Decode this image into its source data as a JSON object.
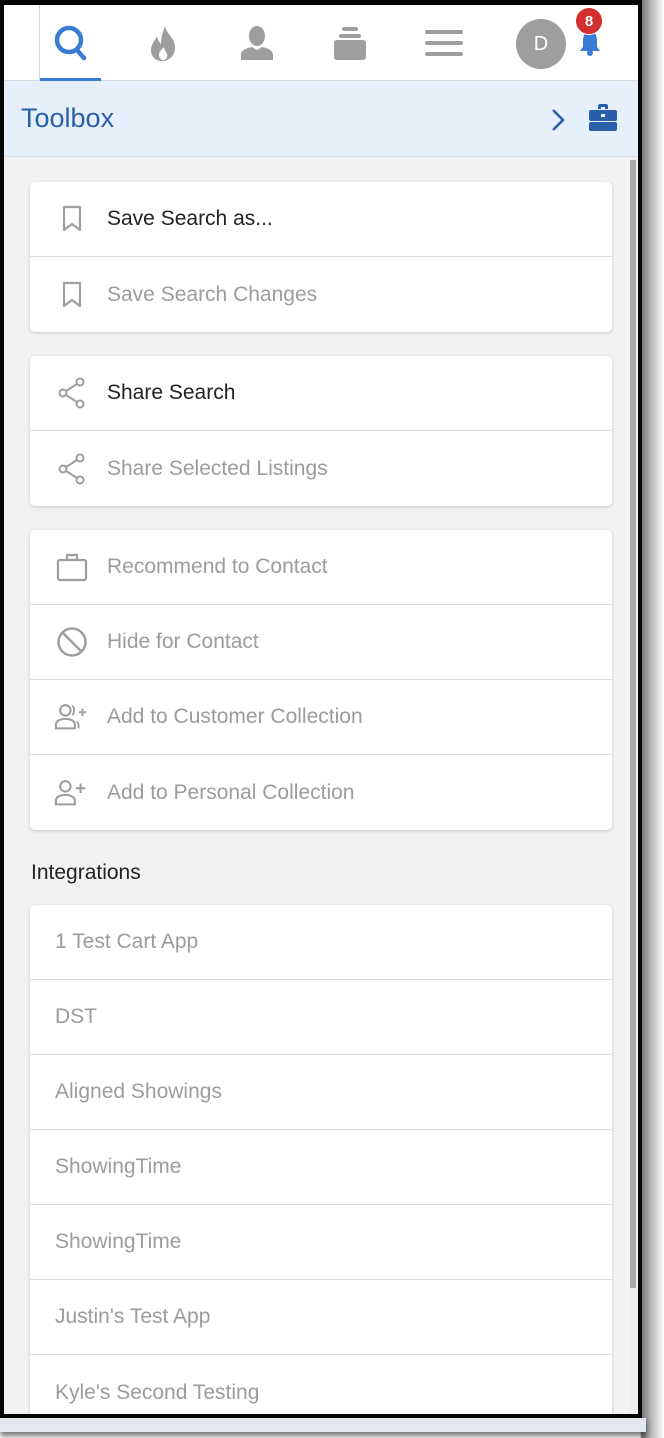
{
  "topnav": {
    "items": [
      {
        "name": "search",
        "active": true
      },
      {
        "name": "hot-sheet"
      },
      {
        "name": "contacts"
      },
      {
        "name": "collections"
      },
      {
        "name": "menu"
      }
    ],
    "avatar_initial": "D",
    "notification_count": "8",
    "colors": {
      "active": "#3a7bd5",
      "inactive": "#9e9e9e",
      "badge": "#d32f2f"
    }
  },
  "toolbox": {
    "title": "Toolbox",
    "title_color": "#2a5ea8",
    "header_bg": "#e6f0fb"
  },
  "groups": [
    {
      "items": [
        {
          "icon": "bookmark-icon",
          "label": "Save Search as...",
          "enabled": true
        },
        {
          "icon": "bookmark-icon",
          "label": "Save Search Changes",
          "enabled": false
        }
      ]
    },
    {
      "items": [
        {
          "icon": "share-icon",
          "label": "Share Search",
          "enabled": true
        },
        {
          "icon": "share-icon",
          "label": "Share Selected Listings",
          "enabled": false
        }
      ]
    },
    {
      "items": [
        {
          "icon": "briefcase-icon",
          "label": "Recommend to Contact",
          "enabled": false
        },
        {
          "icon": "block-icon",
          "label": "Hide for Contact",
          "enabled": false
        },
        {
          "icon": "add-users-icon",
          "label": "Add to Customer Collection",
          "enabled": false
        },
        {
          "icon": "add-user-icon",
          "label": "Add to Personal Collection",
          "enabled": false
        }
      ]
    }
  ],
  "integrations": {
    "title": "Integrations",
    "items": [
      "1 Test Cart App",
      "DST",
      "Aligned Showings",
      "ShowingTime",
      "ShowingTime",
      "Justin's Test App",
      "Kyle's Second Testing"
    ]
  }
}
